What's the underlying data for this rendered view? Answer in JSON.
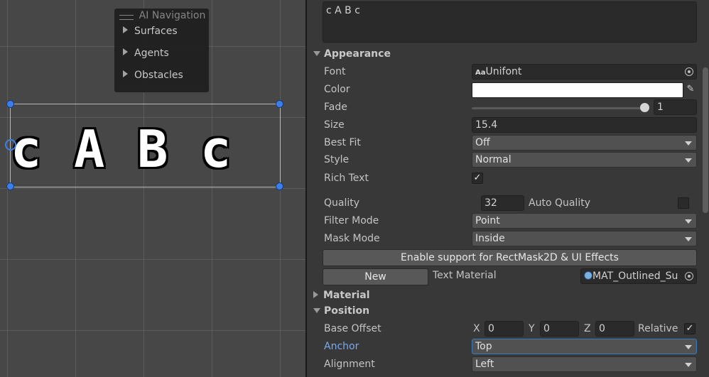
{
  "scene": {
    "ai_navigation": {
      "title": "AI Navigation",
      "items": [
        "Surfaces",
        "Agents",
        "Obstacles"
      ]
    },
    "text_glyphs": [
      "c",
      "A",
      "B",
      "c"
    ]
  },
  "inspector": {
    "text_value": "c A B c",
    "appearance": {
      "header": "Appearance",
      "font_label": "Font",
      "font_value": "Unifont",
      "font_prefix": "Aa",
      "color_label": "Color",
      "color_value": "#ffffff",
      "fade_label": "Fade",
      "fade_value": "1",
      "size_label": "Size",
      "size_value": "15.4",
      "best_fit_label": "Best Fit",
      "best_fit_value": "Off",
      "style_label": "Style",
      "style_value": "Normal",
      "rich_text_label": "Rich Text",
      "rich_text_checked": true,
      "quality_label": "Quality",
      "quality_value": "32",
      "auto_quality_label": "Auto Quality",
      "auto_quality_checked": false,
      "filter_mode_label": "Filter Mode",
      "filter_mode_value": "Point",
      "mask_mode_label": "Mask Mode",
      "mask_mode_value": "Inside",
      "enable_support_label": "Enable support for RectMask2D & UI Effects",
      "new_label": "New",
      "text_material_label": "Text Material",
      "text_material_value": "MAT_Outlined_Su"
    },
    "material": {
      "header": "Material"
    },
    "position": {
      "header": "Position",
      "base_offset_label": "Base Offset",
      "x_label": "X",
      "x_value": "0",
      "y_label": "Y",
      "y_value": "0",
      "z_label": "Z",
      "z_value": "0",
      "relative_label": "Relative",
      "relative_checked": true,
      "anchor_label": "Anchor",
      "anchor_value": "Top",
      "alignment_label": "Alignment",
      "alignment_value": "Left"
    },
    "colors": {
      "accent": "#3d7fe8",
      "anchor_label": "#7aaaf0"
    }
  }
}
